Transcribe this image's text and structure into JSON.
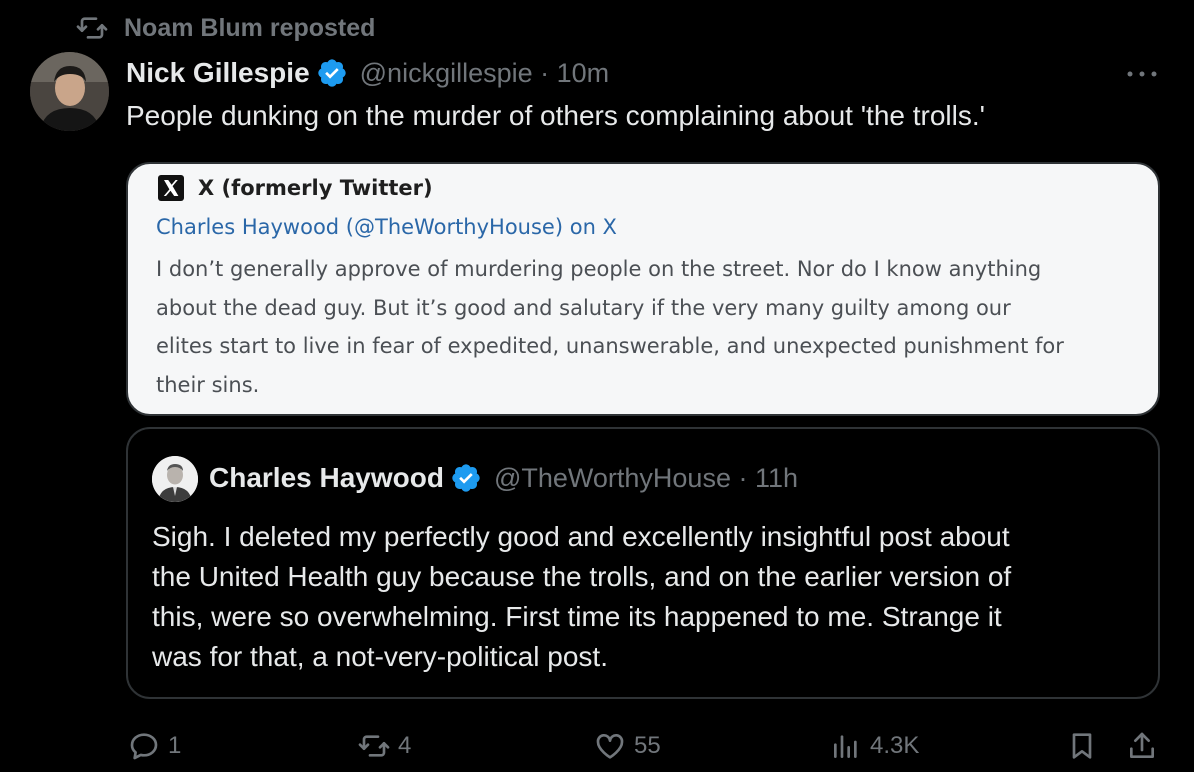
{
  "repost": {
    "text": "Noam Blum reposted"
  },
  "post": {
    "author_name": "Nick Gillespie",
    "author_handle": "@nickgillespie",
    "time": "10m",
    "meta": "@nickgillespie · 10m",
    "text": "People dunking on the murder of others complaining about 'the trolls.'"
  },
  "link_card": {
    "site": "X (formerly Twitter)",
    "title": "Charles Haywood (@TheWorthyHouse) on X",
    "description_lines": [
      "I don’t generally approve of murdering people on the street. Nor do I know anything",
      "about the dead guy. But it’s good and salutary if the very many guilty among our",
      "elites start to live in fear of expedited, unanswerable, and unexpected punishment for",
      "their sins."
    ]
  },
  "quoted_post": {
    "author_name": "Charles Haywood",
    "meta": "@TheWorthyHouse · 11h",
    "text_lines": [
      "Sigh.  I deleted my perfectly good and excellently insightful post about",
      "the United Health guy because the trolls, and on the earlier version of",
      "this, were so overwhelming.  First time its happened to me. Strange it",
      "was for that, a not-very-political post."
    ]
  },
  "actions": {
    "replies": "1",
    "reposts": "4",
    "likes": "55",
    "views": "4.3K"
  },
  "colors": {
    "background": "#000000",
    "text": "#e7e9ea",
    "muted": "#71767b",
    "verified": "#1d9bf0",
    "card_background": "#f6f7f8",
    "card_link": "#2a67a8",
    "border": "#2f3336"
  },
  "icons": [
    "repost-icon",
    "verified-badge-icon",
    "more-icon",
    "x-logo-icon",
    "reply-icon",
    "like-icon",
    "views-icon",
    "bookmark-icon",
    "share-icon"
  ]
}
